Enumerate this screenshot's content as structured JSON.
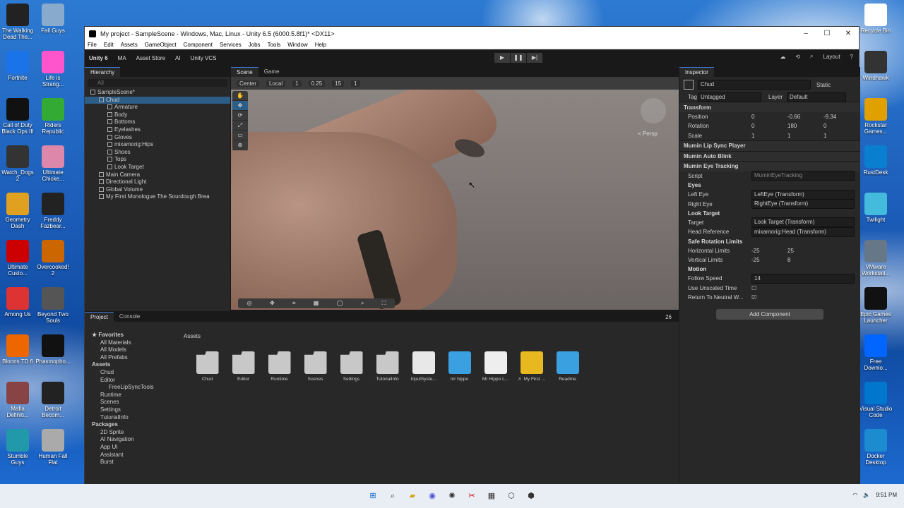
{
  "window": {
    "title": "My project - SampleScene - Windows, Mac, Linux - Unity 6.5 (6000.5.8f1)* <DX11>",
    "controls": {
      "min": "–",
      "max": "☐",
      "close": "✕"
    }
  },
  "menu": [
    "File",
    "Edit",
    "Assets",
    "GameObject",
    "Component",
    "Services",
    "Jobs",
    "Tools",
    "Window",
    "Help"
  ],
  "toolbar": {
    "unity": "Unity 6",
    "account": "MA",
    "store": "Asset Store",
    "ai": "AI",
    "vcs": "Unity VCS",
    "layout": "Layout"
  },
  "hierarchy": {
    "tab": "Hierarchy",
    "search": "All",
    "items": [
      {
        "label": "SampleScene*",
        "depth": 0,
        "kind": "scene"
      },
      {
        "label": "Chud",
        "depth": 1,
        "kind": "go",
        "selected": true
      },
      {
        "label": "Armature",
        "depth": 2,
        "kind": "go"
      },
      {
        "label": "Body",
        "depth": 2,
        "kind": "go"
      },
      {
        "label": "Bottoms",
        "depth": 2,
        "kind": "go"
      },
      {
        "label": "Eyelashes",
        "depth": 2,
        "kind": "go"
      },
      {
        "label": "Gloves",
        "depth": 2,
        "kind": "go"
      },
      {
        "label": "mixamorig:Hips",
        "depth": 2,
        "kind": "go"
      },
      {
        "label": "Shoes",
        "depth": 2,
        "kind": "go"
      },
      {
        "label": "Tops",
        "depth": 2,
        "kind": "go"
      },
      {
        "label": "Look Target",
        "depth": 2,
        "kind": "go"
      },
      {
        "label": "Main Camera",
        "depth": 1,
        "kind": "go"
      },
      {
        "label": "Directional Light",
        "depth": 1,
        "kind": "go"
      },
      {
        "label": "Global Volume",
        "depth": 1,
        "kind": "go"
      },
      {
        "label": "My First Monologue The Sourdough Brea",
        "depth": 1,
        "kind": "go"
      }
    ]
  },
  "scene": {
    "tabs": [
      "Scene",
      "Game"
    ],
    "pivot": "Center",
    "space": "Local",
    "grid": "1",
    "snap": "0.25",
    "angle": "15",
    "scale": "1",
    "persp": "< Persp"
  },
  "inspector": {
    "tab": "Inspector",
    "name": "Chud",
    "static": "Static",
    "tag_label": "Tag",
    "tag": "Untagged",
    "layer_label": "Layer",
    "layer": "Default",
    "transform": {
      "title": "Transform",
      "pos": [
        "0",
        "-0.66",
        "-9.34"
      ],
      "rot": [
        "0",
        "180",
        "0"
      ],
      "scale": [
        "1",
        "1",
        "1"
      ],
      "pos_l": "Position",
      "rot_l": "Rotation",
      "scale_l": "Scale"
    },
    "comps": [
      "Mumin Lip Sync Player",
      "Mumin Auto Blink",
      "Mumin Eye Tracking"
    ],
    "script_label": "Script",
    "script": "MuminEyeTracking",
    "eyes_h": "Eyes",
    "left_l": "Left Eye",
    "left": "LeftEye (Transform)",
    "right_l": "Right Eye",
    "right": "RightEye (Transform)",
    "look_h": "Look Target",
    "target_l": "Target",
    "target": "Look Target (Transform)",
    "head_l": "Head Reference",
    "head": "mixamorig:Head (Transform)",
    "limits_h": "Safe Rotation Limits",
    "hl_l": "Horizontal Limits",
    "hl": [
      "-25",
      "25"
    ],
    "vl_l": "Vertical Limits",
    "vl": [
      "-25",
      "8"
    ],
    "motion_h": "Motion",
    "fs_l": "Follow Speed",
    "fs": "14",
    "uut_l": "Use Unscaled Time",
    "rtn_l": "Return To Neutral W...",
    "add": "Add Component"
  },
  "project": {
    "tabs": [
      "Project",
      "Console"
    ],
    "count": "26",
    "breadcrumb": "Assets",
    "tree": [
      "★ Favorites",
      "All Materials",
      "All Models",
      "All Prefabs",
      "Assets",
      "Chud",
      "Editor",
      "FreeLipSyncTools",
      "Runtime",
      "Scenes",
      "Settings",
      "TutorialInfo",
      "Packages",
      "2D Sprite",
      "AI Navigation",
      "App UI",
      "Assistant",
      "Burst"
    ],
    "assets": [
      {
        "name": "Chud",
        "kind": "folder"
      },
      {
        "name": "Editor",
        "kind": "folder"
      },
      {
        "name": "Runtime",
        "kind": "folder"
      },
      {
        "name": "Scenes",
        "kind": "folder"
      },
      {
        "name": "Settings",
        "kind": "folder"
      },
      {
        "name": "TutorialInfo",
        "kind": "folder"
      },
      {
        "name": "InputSyste...",
        "kind": "input"
      },
      {
        "name": "mr hippo",
        "kind": "script"
      },
      {
        "name": "Mr Hippo L...",
        "kind": "text"
      },
      {
        "name": "♬ My First ...",
        "kind": "audio"
      },
      {
        "name": "Readme",
        "kind": "script"
      }
    ]
  },
  "desktop": {
    "left": [
      [
        "The Walking Dead The..."
      ],
      [
        "Fortnite"
      ],
      [
        "Call of Duty Black Ops III"
      ],
      [
        "Watch_Dogs 2"
      ],
      [
        "Geometry Dash"
      ],
      [
        "Ultimate Custo..."
      ],
      [
        "Among Us"
      ],
      [
        "Bloons TD 6"
      ],
      [
        "Mafia Definiti..."
      ],
      [
        "Stumble Guys"
      ]
    ],
    "left2": [
      [
        "Fall Guys"
      ],
      [
        "Life is Strang..."
      ],
      [
        "Riders Republic"
      ],
      [
        "Ultimate Chicke..."
      ],
      [
        "Freddy Fazbear..."
      ],
      [
        "Overcooked! 2"
      ],
      [
        "Beyond Two Souls"
      ],
      [
        "Phasmopho..."
      ],
      [
        "Detroit Becom..."
      ],
      [
        "Human Fall Flat"
      ]
    ],
    "right": [
      [
        "Recycle Bin"
      ],
      [
        "Windhawk"
      ],
      [
        "Rockstar Games..."
      ],
      [
        "RustDesk"
      ],
      [
        "Twilight"
      ],
      [
        "VMware Workstati..."
      ],
      [
        "Epic Games Launcher"
      ],
      [
        "Free Downlo..."
      ],
      [
        "Visual Studio Code"
      ],
      [
        "Docker Desktop"
      ]
    ]
  },
  "taskbar": {
    "time": "9:51 PM"
  }
}
